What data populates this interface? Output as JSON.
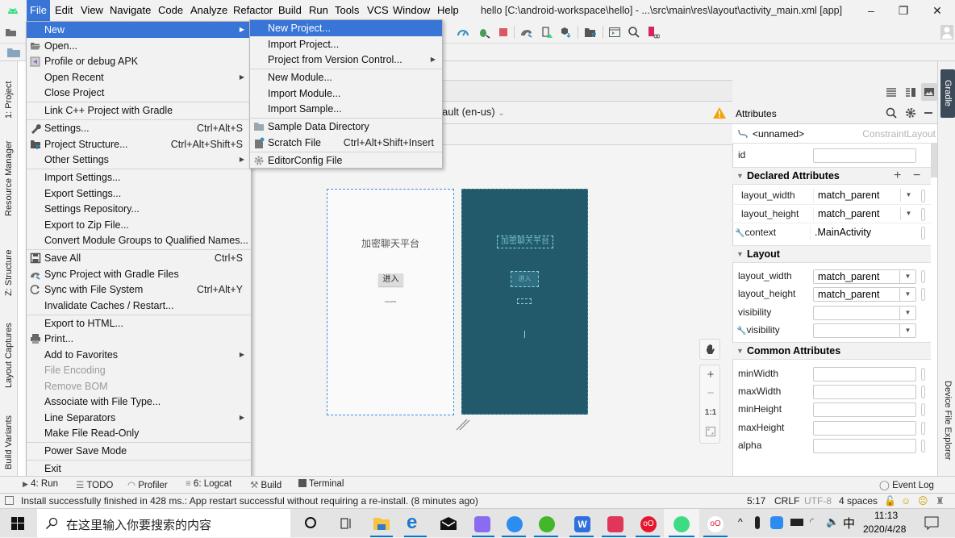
{
  "menubar": {
    "items": [
      "File",
      "Edit",
      "View",
      "Navigate",
      "Code",
      "Analyze",
      "Refactor",
      "Build",
      "Run",
      "Tools",
      "VCS",
      "Window",
      "Help"
    ],
    "active": "File"
  },
  "window": {
    "title": "hello [C:\\android-workspace\\hello] - ...\\src\\main\\res\\layout\\activity_main.xml [app]",
    "minimize": "–",
    "restore": "❐",
    "close": "✕"
  },
  "file_menu": {
    "items": [
      {
        "label": "New",
        "submenu": true,
        "highlighted": true
      },
      {
        "label": "Open...",
        "icon": "folder-open-icon"
      },
      {
        "label": "Profile or debug APK",
        "icon": "profile-apk-icon"
      },
      {
        "label": "Open Recent",
        "submenu": true
      },
      {
        "label": "Close Project"
      },
      {
        "label": "Link C++ Project with Gradle"
      },
      {
        "label": "Settings...",
        "shortcut": "Ctrl+Alt+S",
        "icon": "wrench-icon"
      },
      {
        "label": "Project Structure...",
        "shortcut": "Ctrl+Alt+Shift+S",
        "icon": "project-structure-icon"
      },
      {
        "label": "Other Settings",
        "submenu": true
      },
      {
        "label": "Import Settings..."
      },
      {
        "label": "Export Settings..."
      },
      {
        "label": "Settings Repository..."
      },
      {
        "label": "Export to Zip File..."
      },
      {
        "label": "Convert Module Groups to Qualified Names..."
      },
      {
        "label": "Save All",
        "shortcut": "Ctrl+S",
        "icon": "save-icon"
      },
      {
        "label": "Sync Project with Gradle Files",
        "icon": "gradle-sync-icon"
      },
      {
        "label": "Sync with File System",
        "shortcut": "Ctrl+Alt+Y",
        "icon": "refresh-icon"
      },
      {
        "label": "Invalidate Caches / Restart..."
      },
      {
        "label": "Export to HTML..."
      },
      {
        "label": "Print...",
        "icon": "printer-icon"
      },
      {
        "label": "Add to Favorites",
        "submenu": true
      },
      {
        "label": "File Encoding",
        "disabled": true
      },
      {
        "label": "Remove BOM",
        "disabled": true
      },
      {
        "label": "Associate with File Type..."
      },
      {
        "label": "Line Separators",
        "submenu": true
      },
      {
        "label": "Make File Read-Only"
      },
      {
        "label": "Power Save Mode"
      },
      {
        "label": "Exit"
      }
    ]
  },
  "new_submenu": {
    "items": [
      {
        "label": "New Project...",
        "highlighted": true
      },
      {
        "label": "Import Project..."
      },
      {
        "label": "Project from Version Control...",
        "submenu": true
      },
      {
        "label": "New Module..."
      },
      {
        "label": "Import Module..."
      },
      {
        "label": "Import Sample..."
      },
      {
        "label": "Sample Data Directory",
        "icon": "folder-icon"
      },
      {
        "label": "Scratch File",
        "shortcut": "Ctrl+Alt+Shift+Insert",
        "icon": "scratch-file-icon"
      },
      {
        "label": "EditorConfig File",
        "icon": "gear-icon"
      }
    ]
  },
  "left_strip": {
    "tabs": [
      "1: Project",
      "Resource Manager",
      "Z: Structure",
      "Layout Captures",
      "Build Variants"
    ]
  },
  "right_strip": {
    "tabs": [
      "Gradle",
      "Device File Explorer"
    ]
  },
  "design": {
    "locale": "ault (en-us)",
    "preview": {
      "title": "加密聊天平台",
      "button": "进入",
      "status": "success"
    },
    "blueprint": {
      "title": "加密聊天平台",
      "button": "进入"
    },
    "zoom_controls": {
      "zoom_in": "+",
      "zoom_out": "−",
      "actual": "1:1"
    }
  },
  "attributes": {
    "title": "Attributes",
    "component_name": "<unnamed>",
    "component_type": "ConstraintLayout",
    "id_label": "id",
    "id_value": "",
    "declared_section": "Declared Attributes",
    "declared": [
      {
        "name": "layout_width",
        "value": "match_parent"
      },
      {
        "name": "layout_height",
        "value": "match_parent"
      },
      {
        "name": "context",
        "value": ".MainActivity"
      }
    ],
    "layout_section": "Layout",
    "layout": [
      {
        "name": "layout_width",
        "value": "match_parent"
      },
      {
        "name": "layout_height",
        "value": "match_parent"
      },
      {
        "name": "visibility",
        "value": ""
      },
      {
        "name": "visibility",
        "value": ""
      }
    ],
    "common_section": "Common Attributes",
    "common": [
      {
        "name": "minWidth",
        "value": ""
      },
      {
        "name": "maxWidth",
        "value": ""
      },
      {
        "name": "minHeight",
        "value": ""
      },
      {
        "name": "maxHeight",
        "value": ""
      },
      {
        "name": "alpha",
        "value": ""
      }
    ]
  },
  "bottom_tools": {
    "run": "4: Run",
    "todo": "TODO",
    "profiler": "Profiler",
    "logcat": "6: Logcat",
    "build": "Build",
    "terminal": "Terminal",
    "event_log": "Event Log"
  },
  "status": {
    "message": "Install successfully finished in 428 ms.: App restart successful without requiring a re-install. (8 minutes ago)",
    "position": "5:17",
    "line_sep": "CRLF",
    "encoding": "UTF-8",
    "indent": "4 spaces"
  },
  "taskbar": {
    "search_placeholder": "在这里输入你要搜索的内容",
    "time": "11:13",
    "date": "2020/4/28",
    "ime": "中"
  }
}
